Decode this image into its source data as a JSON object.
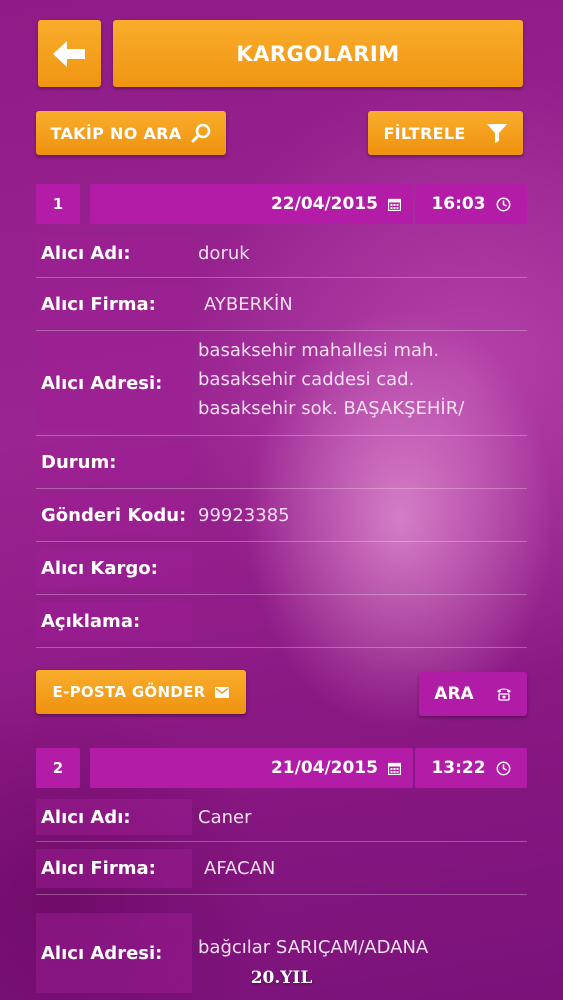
{
  "header": {
    "title": "KARGOLARIM"
  },
  "toolbar": {
    "search_label": "TAKİP NO ARA",
    "filter_label": "FİLTRELE"
  },
  "records": [
    {
      "number": "1",
      "date": "22/04/2015",
      "time": "16:03",
      "fields": [
        {
          "label": "Alıcı Adı:",
          "value": "doruk"
        },
        {
          "label": "Alıcı Firma:",
          "value": "AYBERKİN"
        },
        {
          "label": "Alıcı Adresi:",
          "value": "basaksehir mahallesi mah. basaksehir caddesi cad. basaksehir sok. BAŞAKŞEHİR/"
        },
        {
          "label": "Durum:",
          "value": ""
        },
        {
          "label": "Gönderi Kodu:",
          "value": "99923385"
        },
        {
          "label": "Alıcı Kargo:",
          "value": ""
        },
        {
          "label": "Açıklama:",
          "value": ""
        }
      ],
      "actions": {
        "email_label": "E-POSTA GÖNDER",
        "call_label": "ARA"
      }
    },
    {
      "number": "2",
      "date": "21/04/2015",
      "time": "13:22",
      "fields": [
        {
          "label": "Alıcı Adı:",
          "value": "Caner"
        },
        {
          "label": "Alıcı Firma:",
          "value": "AFACAN"
        },
        {
          "label": "Alıcı Adresi:",
          "value": "bağcılar SARIÇAM/ADANA"
        }
      ]
    }
  ],
  "footer": {
    "logo_text": "20.YIL"
  },
  "colors": {
    "accent_orange": "#f5a11e",
    "header_magenta": "#b21ca7",
    "background": "#8d1a86"
  }
}
